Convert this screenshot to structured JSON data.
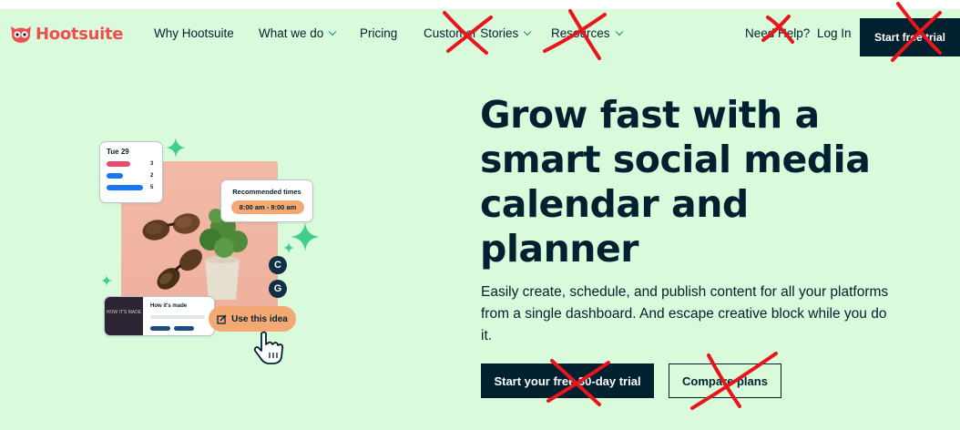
{
  "nav": {
    "logo": "Hootsuite",
    "items": [
      {
        "label": "Why Hootsuite",
        "has_dropdown": false
      },
      {
        "label": "What we do",
        "has_dropdown": true
      },
      {
        "label": "Pricing",
        "has_dropdown": false
      },
      {
        "label": "Customer Stories",
        "has_dropdown": true
      },
      {
        "label": "Resources",
        "has_dropdown": true
      }
    ],
    "need_help": "Need Help?",
    "login": "Log In",
    "cta": "Start free trial"
  },
  "hero": {
    "headline": "Grow fast with a smart social media calendar and planner",
    "subtext": "Easily create, schedule, and publish content for all your platforms from a single dashboard. And escape creative block while you do it.",
    "primary_cta": "Start your free 30-day trial",
    "secondary_cta": "Compare plans"
  },
  "illustration": {
    "calendar_card": {
      "date": "Tue 29",
      "rows": [
        {
          "value": "3",
          "color": "#e94b6e"
        },
        {
          "value": "2",
          "color": "#1877f2"
        },
        {
          "value": "5",
          "color": "#1877f2"
        }
      ]
    },
    "recommended_card": {
      "title": "Recommended times",
      "time": "8:00 am - 9:00 am"
    },
    "idea_card": {
      "thumbnail_text": "HOW IT'S MADE",
      "title": "How it's made"
    },
    "use_idea_button": "Use this idea",
    "social_icons": [
      "canva-icon",
      "grammarly-icon"
    ]
  },
  "colors": {
    "background": "#d9fbdc",
    "navy": "#012130",
    "brand_red": "#ee4f4f",
    "accent_orange": "#f4a874",
    "sparkle_green": "#3fce8b",
    "annotation_red": "#e8161b"
  }
}
